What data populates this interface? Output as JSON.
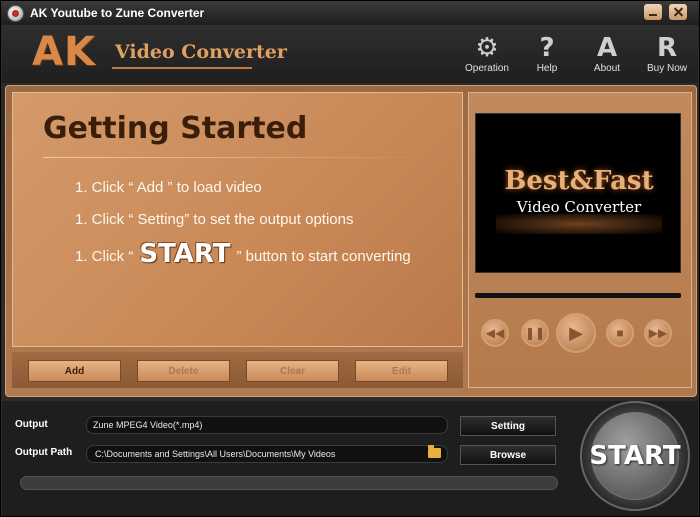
{
  "window": {
    "title": "AK Youtube to Zune Converter"
  },
  "header": {
    "logo_ak": "AK",
    "logo_text": "Video Converter",
    "toolbar": [
      {
        "label": "Operation",
        "icon": "gear-icon"
      },
      {
        "label": "Help",
        "icon": "question-icon"
      },
      {
        "label": "About",
        "icon": "letter-a-icon"
      },
      {
        "label": "Buy Now",
        "icon": "letter-r-icon"
      }
    ]
  },
  "getting_started": {
    "title": "Getting Started",
    "step1": "1. Click “ Add ” to load video",
    "step2": "1. Click “ Setting” to set the output options",
    "step3_prefix": "1. Click “",
    "step3_start": "START",
    "step3_suffix": "” button to start converting"
  },
  "actions": {
    "add": "Add",
    "delete": "Delete",
    "clear": "Clear",
    "edit": "Edit"
  },
  "preview": {
    "title": "Best&Fast",
    "subtitle": "Video Converter"
  },
  "output": {
    "output_label": "Output",
    "output_value": "Zune MPEG4 Video(*.mp4)",
    "setting_button": "Setting",
    "path_label": "Output Path",
    "path_value": "C:\\Documents and Settings\\All Users\\Documents\\My Videos",
    "browse_button": "Browse",
    "progress_percent": 0
  },
  "start_button": "START",
  "colors": {
    "accent": "#d88848",
    "panel": "#c88856",
    "dark": "#1e1e1e"
  }
}
